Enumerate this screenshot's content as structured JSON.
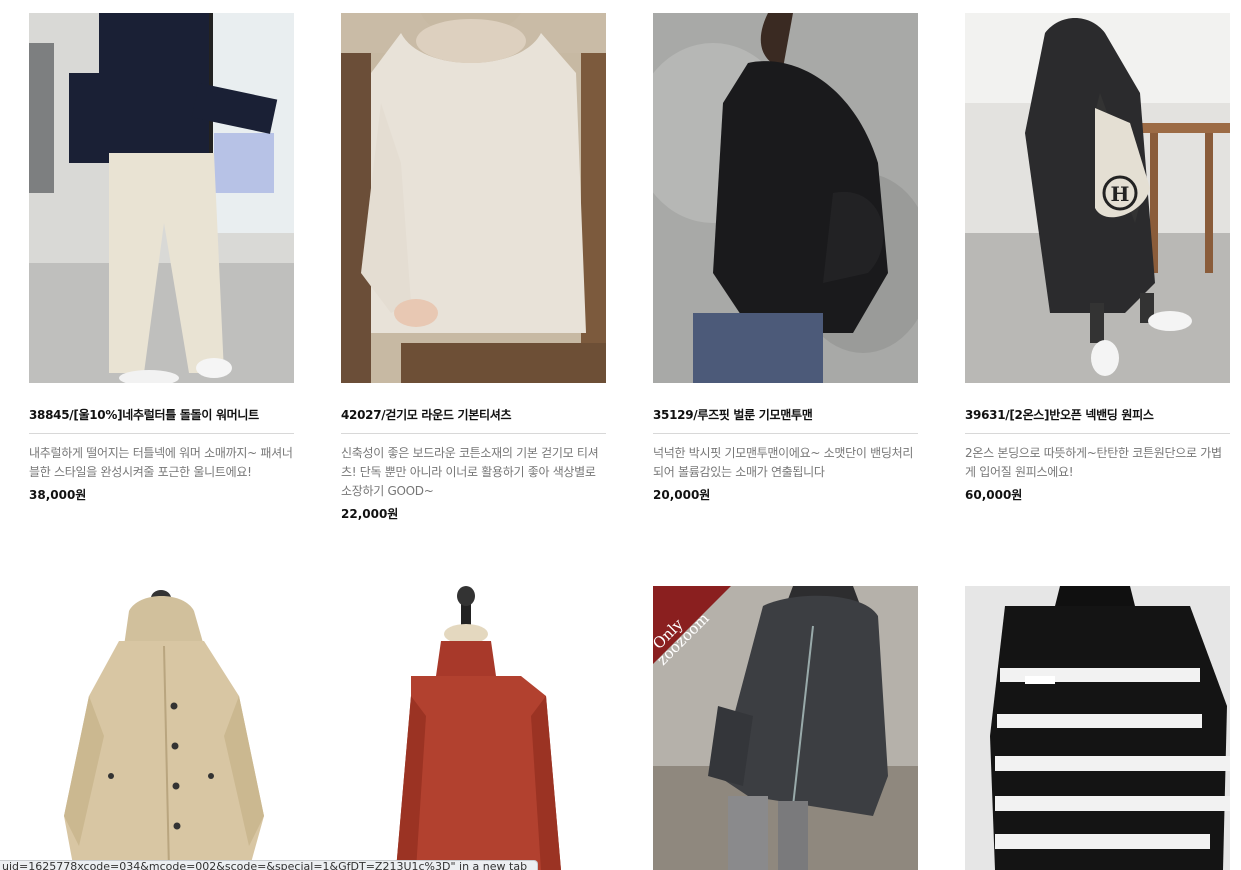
{
  "products": [
    {
      "name": "38845/[울10%]네추럴터틀 돌돌이 워머니트",
      "desc": "내추럴하게 떨어지는 터틀넥에 워머 소매까지~ 패셔너블한 스타일을 완성시켜줄 포근한 울니트에요!",
      "price": "38,000원"
    },
    {
      "name": "42027/걷기모 라운드 기본티셔츠",
      "desc": "신축성이 좋은 보드라운 코튼소재의 기본 걷기모 티셔츠! 단독 뿐만 아니라 이너로 활용하기 좋아 색상별로 소장하기 GOOD~",
      "price": "22,000원"
    },
    {
      "name": "35129/루즈핏 벌룬 기모맨투맨",
      "desc": "넉넉한 박시핏 기모맨투맨이에요~ 소맷단이 밴딩처리 되어 볼륨감있는 소매가 연출됩니다",
      "price": "20,000원"
    },
    {
      "name": "39631/[2온스]반오픈 넥밴딩 원피스",
      "desc": "2온스 본딩으로 따뜻하게~탄탄한 코튼원단으로 가볍게 입어질 원피스에요!",
      "price": "60,000원"
    }
  ],
  "badge": {
    "line1": "Only",
    "line2": "zoozoom"
  },
  "bag_letter": "H",
  "status_bar": "uid=1625778xcode=034&mcode=002&scode=&special=1&GfDT=Z213U1c%3D\" in a new tab",
  "colors": {
    "accent_badge": "#8a1f1f",
    "text": "#111111",
    "desc": "#777777"
  }
}
